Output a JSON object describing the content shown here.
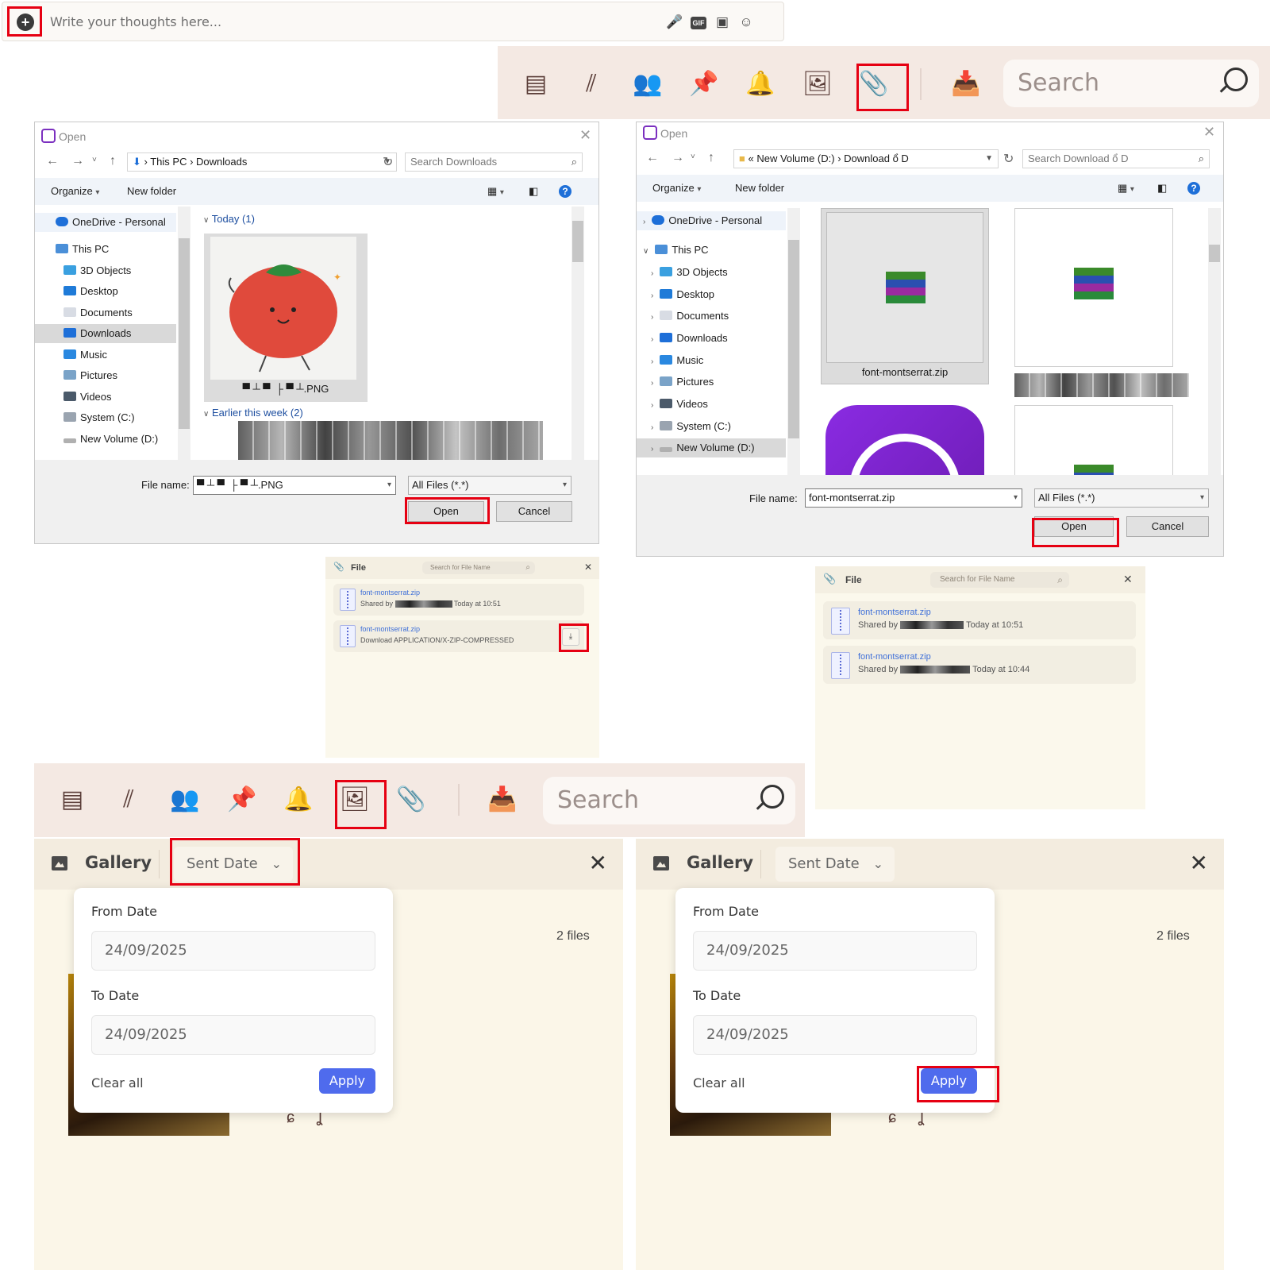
{
  "composer": {
    "placeholder": "Write your thoughts here...",
    "gif_label": "GIF"
  },
  "toolbar": {
    "search_placeholder": "Search",
    "icons": [
      "notes-icon",
      "calls-icon",
      "members-icon",
      "pin-icon",
      "bell-icon",
      "image-icon",
      "paperclip-icon",
      "inbox-icon"
    ]
  },
  "dialog_left": {
    "title": "Open",
    "path": [
      "This PC",
      "Downloads"
    ],
    "search_placeholder": "Search Downloads",
    "organize": "Organize",
    "new_folder": "New folder",
    "tree": [
      "OneDrive - Personal",
      "This PC",
      "3D Objects",
      "Desktop",
      "Documents",
      "Downloads",
      "Music",
      "Pictures",
      "Videos",
      "System (C:)",
      "New Volume (D:)"
    ],
    "selected": "Downloads",
    "group_today": "Today (1)",
    "group_earlier": "Earlier this week (2)",
    "thumb_caption": ".PNG",
    "file_name_label": "File name:",
    "file_name_value": ".PNG",
    "filter": "All Files (*.*)",
    "open": "Open",
    "cancel": "Cancel"
  },
  "dialog_right": {
    "title": "Open",
    "path_prefix": "«",
    "path": [
      "New Volume (D:)",
      "Download ổ D"
    ],
    "search_placeholder": "Search Download ổ D",
    "organize": "Organize",
    "new_folder": "New folder",
    "tree": [
      "OneDrive - Personal",
      "This PC",
      "3D Objects",
      "Desktop",
      "Documents",
      "Downloads",
      "Music",
      "Pictures",
      "Videos",
      "System (C:)",
      "New Volume (D:)"
    ],
    "selected": "New Volume (D:)",
    "tile_caption": "font-montserrat.zip",
    "file_name_label": "File name:",
    "file_name_value": "font-montserrat.zip",
    "filter": "All Files (*.*)",
    "open": "Open",
    "cancel": "Cancel"
  },
  "file_panel_left": {
    "title": "File",
    "search_placeholder": "Search for File Name",
    "items": [
      {
        "name": "font-montserrat.zip",
        "prefix": "Shared by",
        "suffix": "Today at 10:51"
      },
      {
        "name": "font-montserrat.zip",
        "prefix": "Download APPLICATION/X-ZIP-COMPRESSED",
        "suffix": ""
      }
    ]
  },
  "file_panel_right": {
    "title": "File",
    "search_placeholder": "Search for File Name",
    "items": [
      {
        "name": "font-montserrat.zip",
        "prefix": "Shared by",
        "suffix": "Today at 10:51"
      },
      {
        "name": "font-montserrat.zip",
        "prefix": "Shared by",
        "suffix": "Today at 10:44"
      }
    ]
  },
  "gallery_left": {
    "title": "Gallery",
    "sort": "Sent Date",
    "count": "2 files",
    "from_label": "From Date",
    "from_value": "24/09/2025",
    "to_label": "To Date",
    "to_value": "24/09/2025",
    "clear": "Clear all",
    "apply": "Apply"
  },
  "gallery_right": {
    "title": "Gallery",
    "sort": "Sent Date",
    "count": "2 files",
    "from_label": "From Date",
    "from_value": "24/09/2025",
    "to_label": "To Date",
    "to_value": "24/09/2025",
    "clear": "Clear all",
    "apply": "Apply"
  },
  "colors": {
    "highlight": "#e60012",
    "toolbar_bg": "#f4e9e3",
    "apply_button": "#4f6bed",
    "panel_bg": "#fbf8ec"
  }
}
